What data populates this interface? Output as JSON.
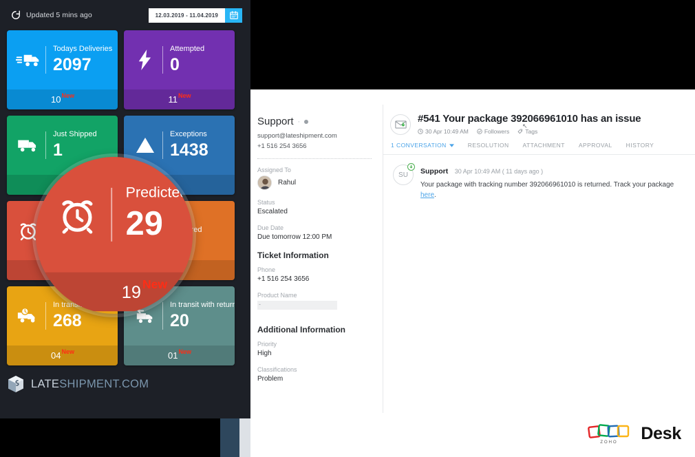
{
  "dashboard": {
    "status_text": "Updated 5 mins ago",
    "refresh_icon": "refresh-icon",
    "date_range": "12.03.2019 - 11.04.2019",
    "calendar_icon": "calendar-icon",
    "cards": [
      {
        "label": "Todays Deliveries",
        "value": "2097",
        "footer_num": "10",
        "footer_tag": "New",
        "icon": "delivery-truck-icon",
        "color": "#0b9ff2"
      },
      {
        "label": "Attempted",
        "value": "0",
        "footer_num": "11",
        "footer_tag": "New",
        "icon": "lightning-bolt-icon",
        "color": "#7230b0"
      },
      {
        "label": "Just Shipped",
        "value": "1",
        "footer_num": "",
        "footer_tag": "",
        "icon": "shipped-truck-icon",
        "color": "#12a366"
      },
      {
        "label": "Exceptions",
        "value": "1438",
        "footer_num": "",
        "footer_tag": "",
        "icon": "warning-icon",
        "color": "#2b72b3"
      },
      {
        "label": "Predicted Delays",
        "value": "29",
        "footer_num": "19",
        "footer_tag": "New",
        "icon": "alarm-clock-icon",
        "color": "#d9503c"
      },
      {
        "label": "Delivered",
        "value": "",
        "footer_num": "",
        "footer_tag": "",
        "icon": "box-icon",
        "color": "#df7126"
      },
      {
        "label": "In transit",
        "value": "268",
        "footer_num": "04",
        "footer_tag": "New",
        "icon": "transit-truck-icon",
        "color": "#e8a413"
      },
      {
        "label": "In transit with returns",
        "value": "20",
        "footer_num": "01",
        "footer_tag": "New",
        "icon": "returns-icon",
        "color": "#5e8e8b"
      }
    ],
    "magnifier": {
      "label": "Predicted Delays",
      "value": "29",
      "footer_num": "19",
      "footer_tag": "New",
      "icon": "alarm-clock-icon"
    },
    "brand": {
      "part1": "LATE",
      "part2": "SHIPMENT.COM",
      "icon": "cube-logo-icon"
    }
  },
  "desk": {
    "sidebar": {
      "contact_name": "Support",
      "presence_icon": "presence-dot-icon",
      "email": "support@lateshipment.com",
      "phone": "+1 516 254 3656",
      "assigned_to_label": "Assigned To",
      "assignee": "Rahul",
      "assignee_avatar": "user-avatar",
      "status_label": "Status",
      "status_value": "Escalated",
      "due_date_label": "Due Date",
      "due_date_value": "Due tomorrow 12:00 PM",
      "ticket_info_heading": "Ticket Information",
      "phone_label": "Phone",
      "phone_value": "+1 516 254 3656",
      "product_label": "Product Name",
      "product_value": "-",
      "additional_heading": "Additional Information",
      "priority_label": "Priority",
      "priority_value": "High",
      "classifications_label": "Classifications",
      "classifications_value": "Problem"
    },
    "ticket": {
      "icon": "email-ticket-icon",
      "number": "#541",
      "subject": "Your package 392066961010 has an issue",
      "time": "30 Apr 10:49 AM",
      "time_icon": "clock-icon",
      "followers": "Followers",
      "followers_icon": "followers-icon",
      "tags": "Tags",
      "tags_icon": "tag-icon",
      "tabs": [
        {
          "label": "1 CONVERSATION",
          "active": true,
          "caret": "chevron-down-icon"
        },
        {
          "label": "RESOLUTION",
          "active": false
        },
        {
          "label": "ATTACHMENT",
          "active": false
        },
        {
          "label": "APPROVAL",
          "active": false
        },
        {
          "label": "HISTORY",
          "active": false
        }
      ]
    },
    "conversation": {
      "avatar_initials": "SU",
      "badge_icon": "reply-badge-icon",
      "sender": "Support",
      "timestamp": "30 Apr 10:49 AM ( 11 days ago )",
      "body_before": "Your package with tracking number 392066961010 is returned. Track your package ",
      "link": "here",
      "body_after": "."
    }
  },
  "footer": {
    "zoho_logo": "zoho-logo-icon",
    "zoho_word": "Desk",
    "zoho_mark": "ZOHO"
  }
}
